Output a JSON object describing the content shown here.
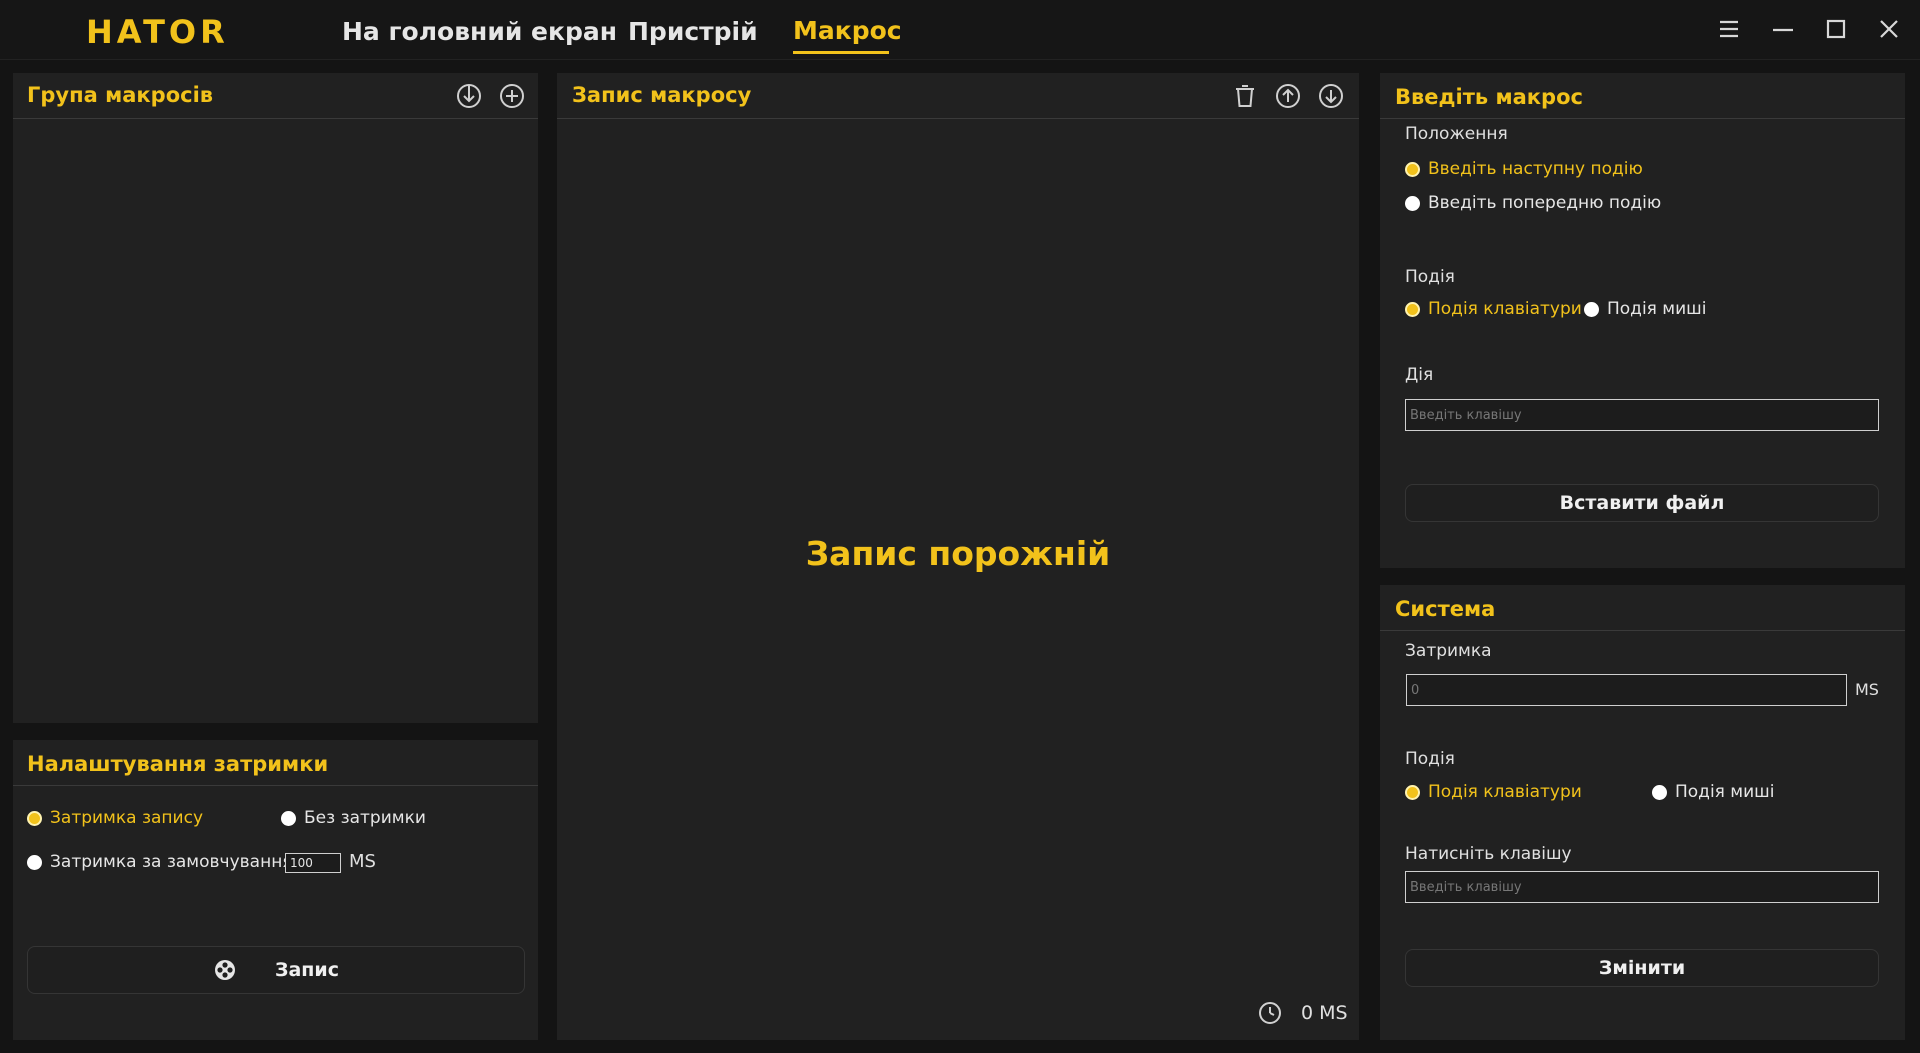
{
  "app": {
    "logo": "HATOR",
    "nav": [
      {
        "label": "На головний екран"
      },
      {
        "label": "Пристрій"
      },
      {
        "label": "Макрос"
      }
    ]
  },
  "macro_group": {
    "title": "Група макросів"
  },
  "delay_settings": {
    "title": "Налаштування затримки",
    "option_record_delay": "Затримка запису",
    "option_no_delay": "Без затримки",
    "option_default_delay": "Затримка за замовчуванням",
    "default_delay_value": "100",
    "unit": "MS",
    "record_button": "Запис"
  },
  "macro_record": {
    "title": "Запис макросу",
    "empty_message": "Запис порожній",
    "total_time": "0 MS"
  },
  "enter_macro": {
    "title": "Введіть макрос",
    "position_label": "Положення",
    "option_next_event": "Введіть наступну подію",
    "option_prev_event": "Введіть попередню подію",
    "event_label": "Подія",
    "option_keyboard": "Подія клавіатури",
    "option_mouse": "Подія миші",
    "action_label": "Дія",
    "key_placeholder": "Введіть клавішу",
    "insert_file_button": "Вставити файл"
  },
  "system": {
    "title": "Система",
    "delay_label": "Затримка",
    "delay_placeholder": "0",
    "unit": "MS",
    "event_label": "Подія",
    "option_keyboard": "Подія клавіатури",
    "option_mouse": "Подія миші",
    "press_key_label": "Натисніть клавішу",
    "key_placeholder": "Введіть клавішу",
    "change_button": "Змінити"
  },
  "colors": {
    "accent": "#f2c21b",
    "panel": "#212121",
    "background": "#141414"
  }
}
